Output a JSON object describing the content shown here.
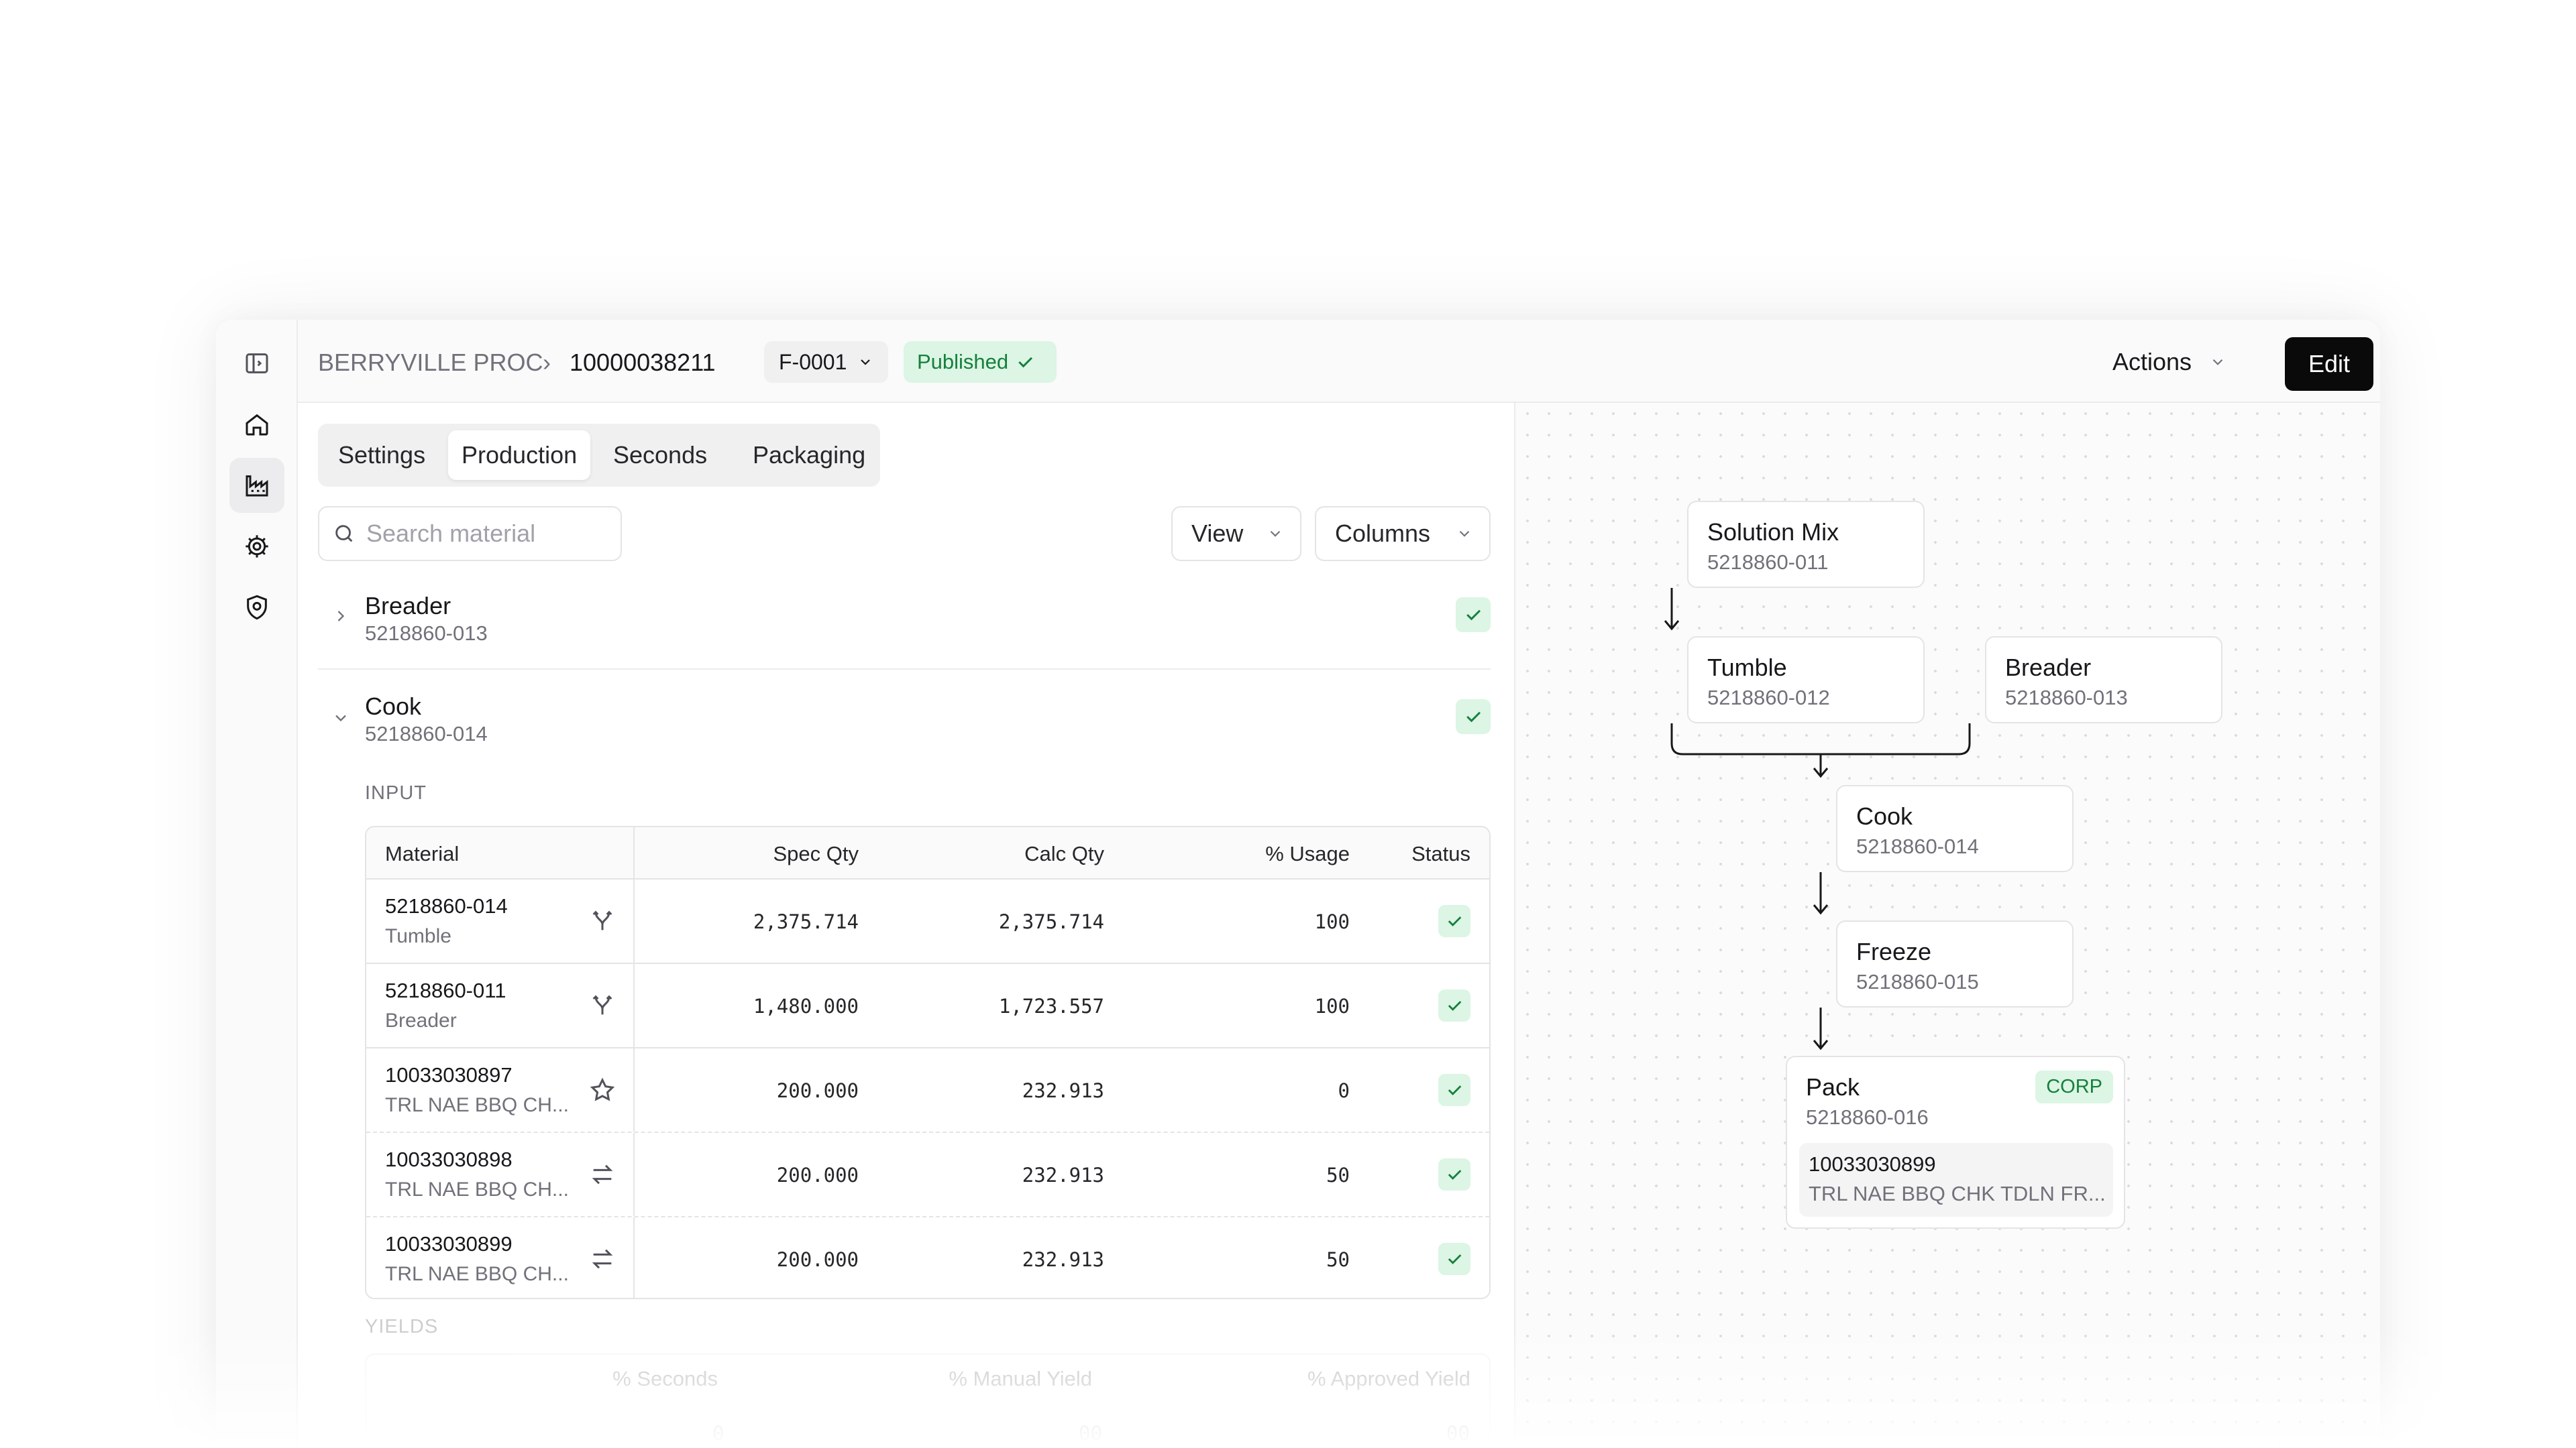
{
  "header": {
    "breadcrumb_root": "BERRYVILLE PROC",
    "breadcrumb_separator": "›",
    "breadcrumb_current": "10000038211",
    "version": "F-0001",
    "status": "Published",
    "actions_label": "Actions",
    "edit_label": "Edit"
  },
  "sidebar": {
    "items": [
      {
        "icon": "panel-toggle-icon"
      },
      {
        "icon": "home-icon"
      },
      {
        "icon": "factory-icon",
        "active": true
      },
      {
        "icon": "gear-icon"
      },
      {
        "icon": "shield-icon"
      }
    ]
  },
  "tabs": [
    {
      "label": "Settings"
    },
    {
      "label": "Production",
      "active": true
    },
    {
      "label": "Seconds"
    },
    {
      "label": "Packaging"
    }
  ],
  "toolbar": {
    "search_placeholder": "Search material",
    "view_label": "View",
    "columns_label": "Columns"
  },
  "steps": [
    {
      "name": "Breader",
      "code": "5218860-013",
      "expanded": false,
      "status": "ok"
    },
    {
      "name": "Cook",
      "code": "5218860-014",
      "expanded": true,
      "status": "ok"
    }
  ],
  "input_section": {
    "label": "INPUT",
    "columns": [
      "Material",
      "Spec Qty",
      "Calc Qty",
      "% Usage",
      "Status"
    ],
    "rows": [
      {
        "id": "5218860-014",
        "desc": "Tumble",
        "icon": "merge-icon",
        "spec": "2,375.714",
        "calc": "2,375.714",
        "usage": "100",
        "status": "ok"
      },
      {
        "id": "5218860-011",
        "desc": "Breader",
        "icon": "merge-icon",
        "spec": "1,480.000",
        "calc": "1,723.557",
        "usage": "100",
        "status": "ok"
      },
      {
        "id": "10033030897",
        "desc": "TRL NAE BBQ CH...",
        "icon": "star-icon",
        "spec": "200.000",
        "calc": "232.913",
        "usage": "0",
        "status": "ok"
      },
      {
        "id": "10033030898",
        "desc": "TRL NAE BBQ CH...",
        "icon": "swap-icon",
        "spec": "200.000",
        "calc": "232.913",
        "usage": "50",
        "status": "ok"
      },
      {
        "id": "10033030899",
        "desc": "TRL NAE BBQ CH...",
        "icon": "swap-icon",
        "spec": "200.000",
        "calc": "232.913",
        "usage": "50",
        "status": "ok"
      }
    ]
  },
  "yields_section": {
    "label": "YIELDS",
    "columns": [
      "% Seconds",
      "% Manual Yield",
      "% Approved Yield"
    ],
    "values": [
      "0",
      "00",
      "00"
    ]
  },
  "flow": {
    "nodes": [
      {
        "name": "Solution Mix",
        "code": "5218860-011"
      },
      {
        "name": "Tumble",
        "code": "5218860-012"
      },
      {
        "name": "Breader",
        "code": "5218860-013"
      },
      {
        "name": "Cook",
        "code": "5218860-014"
      },
      {
        "name": "Freeze",
        "code": "5218860-015"
      },
      {
        "name": "Pack",
        "code": "5218860-016",
        "badge": "CORP",
        "item": {
          "id": "10033030899",
          "desc": "TRL NAE BBQ CHK TDLN FR..."
        }
      }
    ]
  },
  "colors": {
    "accent_green": "#15803d",
    "badge_green_bg": "#dcf5e4",
    "primary_button": "#0a0a0a"
  }
}
